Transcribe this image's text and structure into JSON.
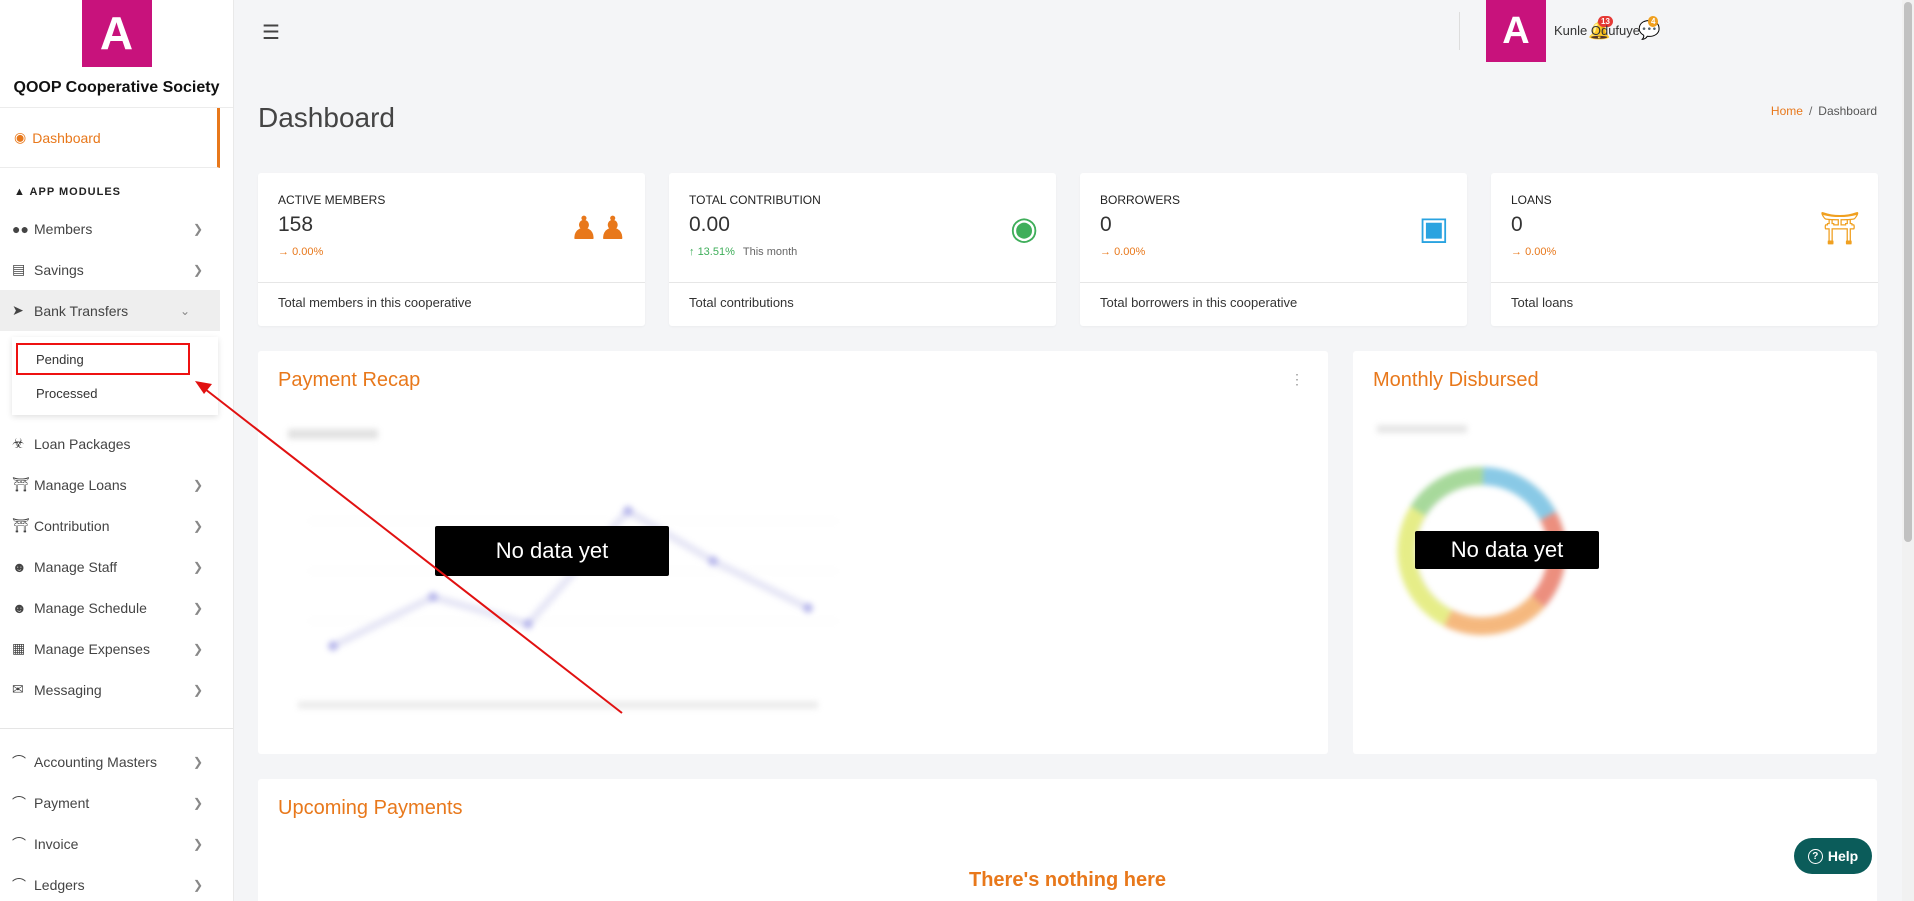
{
  "brand": {
    "logo_letter": "A",
    "name": "QOOP Cooperative Society",
    "color": "#c8127c"
  },
  "sidebar": {
    "dashboard_label": "Dashboard",
    "section_title": "APP MODULES",
    "items": [
      {
        "label": "Members",
        "icon": "users-icon"
      },
      {
        "label": "Savings",
        "icon": "money-icon"
      },
      {
        "label": "Bank Transfers",
        "icon": "paper-plane-icon"
      },
      {
        "label": "Loan Packages",
        "icon": "cart-icon"
      },
      {
        "label": "Manage Loans",
        "icon": "bank-icon"
      },
      {
        "label": "Contribution",
        "icon": "bank-icon"
      },
      {
        "label": "Manage Staff",
        "icon": "user-icon"
      },
      {
        "label": "Manage Schedule",
        "icon": "user-icon"
      },
      {
        "label": "Manage Expenses",
        "icon": "calculator-icon"
      },
      {
        "label": "Messaging",
        "icon": "comments-icon"
      },
      {
        "label": "Accounting Masters",
        "icon": "chart-icon"
      },
      {
        "label": "Payment",
        "icon": "chart-icon"
      },
      {
        "label": "Invoice",
        "icon": "chart-icon"
      },
      {
        "label": "Ledgers",
        "icon": "chart-icon"
      }
    ],
    "bank_transfers_sub": [
      {
        "label": "Pending"
      },
      {
        "label": "Processed"
      }
    ]
  },
  "topbar": {
    "notifications_count": "13",
    "messages_count": "4",
    "user_avatar_letter": "A",
    "user_name": "Kunle Odufuye"
  },
  "header": {
    "title": "Dashboard",
    "breadcrumb_home": "Home",
    "breadcrumb_sep": "/",
    "breadcrumb_current": "Dashboard"
  },
  "stats": [
    {
      "label": "ACTIVE MEMBERS",
      "value": "158",
      "trend": "0.00%",
      "trend_arrow": "→",
      "trend_note": "",
      "footer": "Total members in this cooperative",
      "icon": "users-icon",
      "icon_color": "#e8781b"
    },
    {
      "label": "TOTAL CONTRIBUTION",
      "value": "0.00",
      "trend": "13.51%",
      "trend_arrow": "↑",
      "trend_note": "This month",
      "footer": "Total contributions",
      "icon": "piggy-bank-icon",
      "icon_color": "#3fae5a"
    },
    {
      "label": "BORROWERS",
      "value": "0",
      "trend": "0.00%",
      "trend_arrow": "→",
      "trend_note": "",
      "footer": "Total borrowers in this cooperative",
      "icon": "money-bill-icon",
      "icon_color": "#2aa3e0"
    },
    {
      "label": "LOANS",
      "value": "0",
      "trend": "0.00%",
      "trend_arrow": "→",
      "trend_note": "",
      "footer": "Total loans",
      "icon": "bank-icon",
      "icon_color": "#f0a020"
    }
  ],
  "panels": {
    "payment_recap_title": "Payment Recap",
    "payment_recap_empty": "No data yet",
    "monthly_disbursed_title": "Monthly Disbursed",
    "monthly_disbursed_empty": "No data yet",
    "upcoming_payments_title": "Upcoming Payments",
    "upcoming_payments_empty": "There's nothing here"
  },
  "help_label": "Help",
  "colors": {
    "accent": "#e8781b",
    "annotation": "#e11111",
    "help": "#0b5c5a"
  }
}
